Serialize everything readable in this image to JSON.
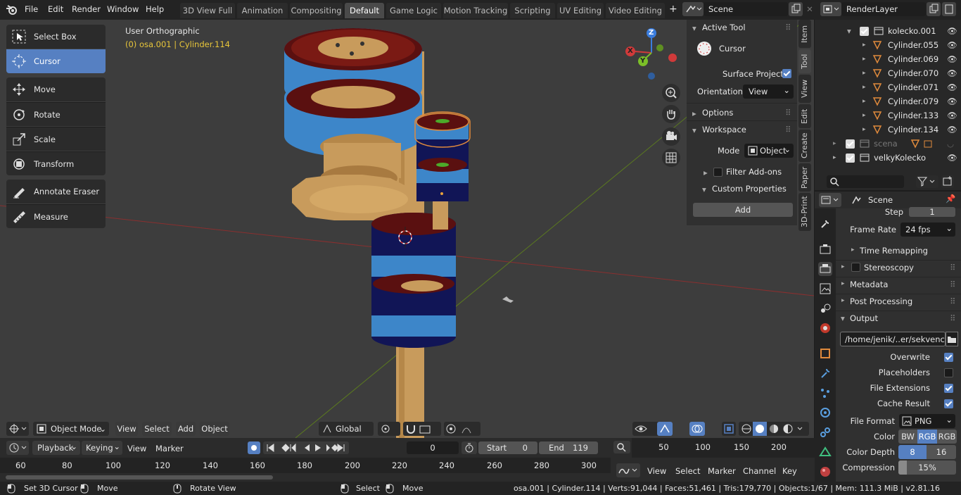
{
  "topbar": {
    "menus": [
      "File",
      "Edit",
      "Render",
      "Window",
      "Help"
    ],
    "workspaces": [
      "3D View Full",
      "Animation",
      "Compositing",
      "Default",
      "Game Logic",
      "Motion Tracking",
      "Scripting",
      "UV Editing",
      "Video Editing"
    ],
    "active_workspace": "Default",
    "add_tab": "+",
    "scene_name": "Scene",
    "render_layer": "RenderLayer"
  },
  "viewport": {
    "view_name": "User Orthographic",
    "active_object": "(0) osa.001 | Cylinder.114",
    "header": {
      "mode": "Object Mode",
      "menus": [
        "View",
        "Select",
        "Add",
        "Object"
      ],
      "orientation": "Global"
    },
    "gizmo": {
      "z": "Z",
      "x": "X",
      "y": "Y"
    }
  },
  "toolbar": {
    "tools": [
      "Select Box",
      "Cursor",
      "Move",
      "Rotate",
      "Scale",
      "Transform",
      "Annotate Eraser",
      "Measure"
    ],
    "active_tool": "Cursor"
  },
  "npanel": {
    "active_tool_title": "Active Tool",
    "tool_name": "Cursor",
    "surface_project": "Surface Project",
    "orientation_label": "Orientation",
    "orientation_value": "View",
    "options": "Options",
    "workspace": "Workspace",
    "mode_label": "Mode",
    "mode_value": "Object",
    "filter_addons": "Filter Add-ons",
    "custom_properties": "Custom Properties",
    "add_button": "Add",
    "tabs": [
      "Item",
      "Tool",
      "View",
      "Edit",
      "Create",
      "Paper",
      "3D-Print"
    ],
    "active_tab": "Tool"
  },
  "outliner": {
    "rows": [
      {
        "name": "kolecko.001",
        "type": "collection"
      },
      {
        "name": "Cylinder.055",
        "type": "mesh"
      },
      {
        "name": "Cylinder.069",
        "type": "mesh"
      },
      {
        "name": "Cylinder.070",
        "type": "mesh"
      },
      {
        "name": "Cylinder.071",
        "type": "mesh"
      },
      {
        "name": "Cylinder.079",
        "type": "mesh"
      },
      {
        "name": "Cylinder.133",
        "type": "mesh"
      },
      {
        "name": "Cylinder.134",
        "type": "mesh"
      },
      {
        "name": "scena",
        "type": "collection-disabled"
      },
      {
        "name": "velkyKolecko",
        "type": "collection"
      }
    ]
  },
  "properties": {
    "context": "Scene",
    "step_label": "Step",
    "step_value": "1",
    "frame_rate_label": "Frame Rate",
    "frame_rate_value": "24 fps",
    "time_remapping": "Time Remapping",
    "stereoscopy": "Stereoscopy",
    "metadata": "Metadata",
    "post_processing": "Post Processing",
    "output": "Output",
    "output_path": "/home/jenik/..er/sekvence/",
    "overwrite": "Overwrite",
    "placeholders": "Placeholders",
    "file_extensions": "File Extensions",
    "cache_result": "Cache Result",
    "file_format_label": "File Format",
    "file_format_value": "PNG",
    "color_label": "Color",
    "color_options": [
      "BW",
      "RGB",
      "RGB"
    ],
    "color_depth_label": "Color Depth",
    "color_depth_options": [
      "8",
      "16"
    ],
    "compression_label": "Compression",
    "compression_value": "15%",
    "compression_fraction": 0.15
  },
  "timeline": {
    "menus": [
      "Playback",
      "Keying",
      "View",
      "Marker"
    ],
    "current_frame": "0",
    "start_label": "Start",
    "start_value": "0",
    "end_label": "End",
    "end_value": "119",
    "ruler": [
      "60",
      "80",
      "100",
      "120",
      "140",
      "160",
      "180",
      "200",
      "220",
      "240",
      "260",
      "280",
      "300"
    ]
  },
  "graph_editor": {
    "ruler": [
      "50",
      "100",
      "150",
      "200"
    ],
    "menus": [
      "View",
      "Select",
      "Marker",
      "Channel",
      "Key"
    ]
  },
  "statusbar": {
    "left": [
      "Set 3D Cursor",
      "Move",
      "Rotate View",
      "Select",
      "Move"
    ],
    "stats": "osa.001 | Cylinder.114 | Verts:91,044 | Faces:51,461 | Tris:179,770 | Objects:1/67 | Mem: 111.3 MiB | v2.81.16"
  },
  "colors": {
    "accent": "#5680c2",
    "viewport_bg": "#3d3d3d",
    "highlight_text": "#e8c63a",
    "mesh_orange": "#e08a3c",
    "part_blue": "#3d86c9",
    "part_navy": "#111556",
    "part_tan": "#c89b5c",
    "part_maroon": "#5a1010"
  }
}
